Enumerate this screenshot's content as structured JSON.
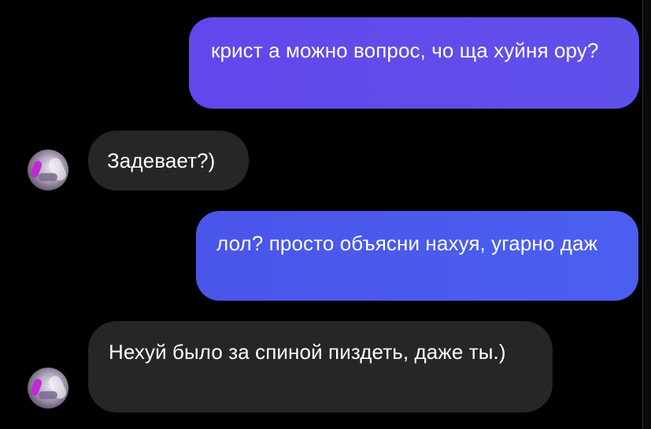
{
  "messages": [
    {
      "direction": "outgoing",
      "text": "крист а можно вопрос, чо ща хуйня ору?"
    },
    {
      "direction": "incoming",
      "text": "Задевает?)"
    },
    {
      "direction": "outgoing",
      "text": "лол? просто объясни нахуя, угарно даж"
    },
    {
      "direction": "incoming",
      "text": "Нехуй было за спиной пиздеть, даже ты.)"
    }
  ],
  "colors": {
    "background": "#000000",
    "outgoing_bubble_1": "#6050ea",
    "outgoing_bubble_2": "#4a5ff0",
    "incoming_bubble": "#262626",
    "text": "#ffffff"
  },
  "icons": {
    "contact_avatar": "anime-character-avatar"
  }
}
